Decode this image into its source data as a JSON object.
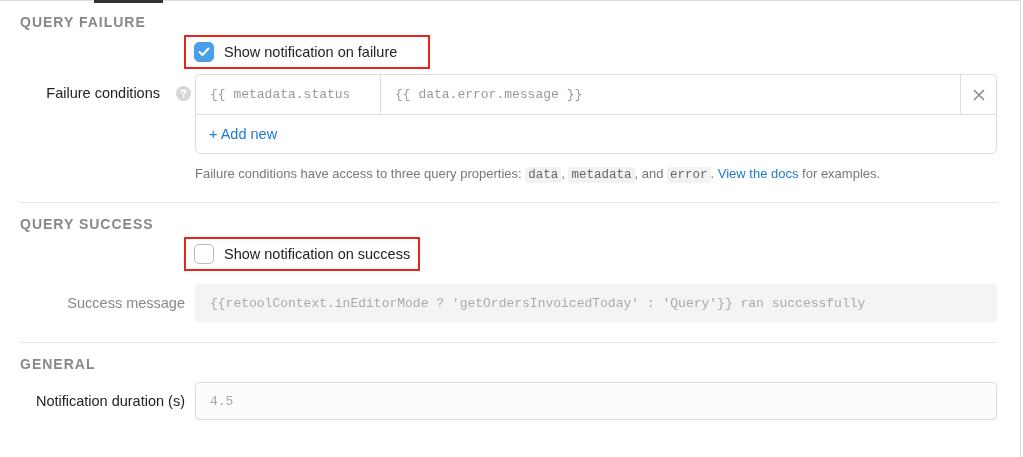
{
  "sections": [
    {
      "kind": "failure",
      "title": "QUERY FAILURE",
      "checkbox": {
        "label": "Show notification on failure",
        "checked": true,
        "highlighted": true
      },
      "conditions": {
        "label": "Failure conditions",
        "rows": [
          {
            "condition": "{{ metadata.status",
            "message": "{{ data.error.message }}"
          }
        ],
        "add_label": "+ Add new"
      },
      "help": [
        {
          "kind": "text",
          "text": "Failure conditions have access to three query properties: "
        },
        {
          "kind": "code",
          "text": "data"
        },
        {
          "kind": "text",
          "text": ", "
        },
        {
          "kind": "code",
          "text": "metadata"
        },
        {
          "kind": "text",
          "text": ", and "
        },
        {
          "kind": "code",
          "text": "error"
        },
        {
          "kind": "text",
          "text": ". "
        },
        {
          "kind": "link",
          "text": "View the docs"
        },
        {
          "kind": "text",
          "text": " for examples."
        }
      ]
    },
    {
      "kind": "success",
      "title": "QUERY SUCCESS",
      "checkbox": {
        "label": "Show notification on success",
        "checked": false,
        "highlighted": true
      },
      "field": {
        "label": "Success message",
        "placeholder": "{{retoolContext.inEditorMode ? 'getOrdersInvoicedToday' : 'Query'}} ran successfully",
        "disabled": true
      }
    },
    {
      "kind": "general",
      "title": "GENERAL",
      "field": {
        "label": "Notification duration (s)",
        "placeholder": "4.5",
        "disabled": false
      }
    }
  ]
}
